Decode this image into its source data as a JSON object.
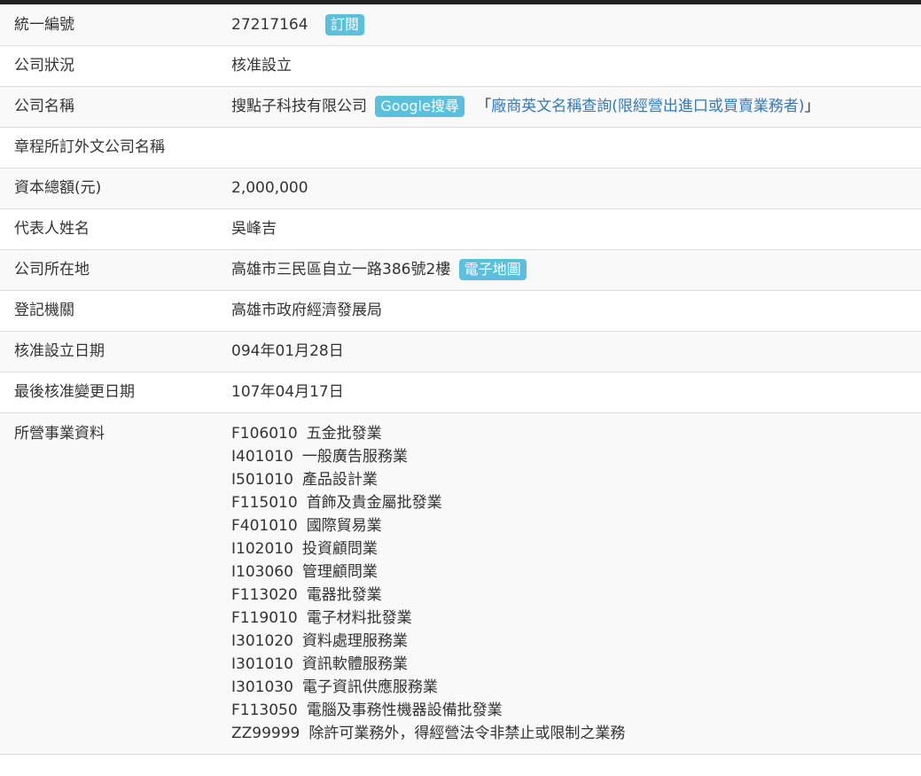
{
  "rows": {
    "uniform_id": {
      "label": "統一編號",
      "value": "27217164",
      "subscribe_label": "訂閱"
    },
    "status": {
      "label": "公司狀況",
      "value": "核准設立"
    },
    "name": {
      "label": "公司名稱",
      "value": "搜點子科技有限公司",
      "google_label": "Google搜尋",
      "quote_open": "「",
      "english_query_link": "廠商英文名稱查詢(限經營出進口或買賣業務者)",
      "quote_close": "」"
    },
    "foreign_name": {
      "label": "章程所訂外文公司名稱",
      "value": ""
    },
    "capital": {
      "label": "資本總額(元)",
      "value": "2,000,000"
    },
    "representative": {
      "label": "代表人姓名",
      "value": "吳峰吉"
    },
    "address": {
      "label": "公司所在地",
      "value": "高雄市三民區自立一路386號2樓",
      "map_label": "電子地圖"
    },
    "authority": {
      "label": "登記機關",
      "value": "高雄市政府經濟發展局"
    },
    "approval_date": {
      "label": "核准設立日期",
      "value": "094年01月28日"
    },
    "last_change_date": {
      "label": "最後核准變更日期",
      "value": "107年04月17日"
    },
    "business": {
      "label": "所營事業資料",
      "items": [
        {
          "code": "F106010",
          "name": "五金批發業"
        },
        {
          "code": "I401010",
          "name": "一般廣告服務業"
        },
        {
          "code": "I501010",
          "name": "產品設計業"
        },
        {
          "code": "F115010",
          "name": "首飾及貴金屬批發業"
        },
        {
          "code": "F401010",
          "name": "國際貿易業"
        },
        {
          "code": "I102010",
          "name": "投資顧問業"
        },
        {
          "code": "I103060",
          "name": "管理顧問業"
        },
        {
          "code": "F113020",
          "name": "電器批發業"
        },
        {
          "code": "F119010",
          "name": "電子材料批發業"
        },
        {
          "code": "I301020",
          "name": "資料處理服務業"
        },
        {
          "code": "I301010",
          "name": "資訊軟體服務業"
        },
        {
          "code": "I301030",
          "name": "電子資訊供應服務業"
        },
        {
          "code": "F113050",
          "name": "電腦及事務性機器設備批發業"
        },
        {
          "code": "ZZ99999",
          "name": "除許可業務外，得經營法令非禁止或限制之業務"
        }
      ]
    }
  },
  "colors": {
    "badge": "#5bc0de",
    "link": "#337ab7",
    "stripe": "#f9f9f9",
    "border": "#dddddd"
  }
}
